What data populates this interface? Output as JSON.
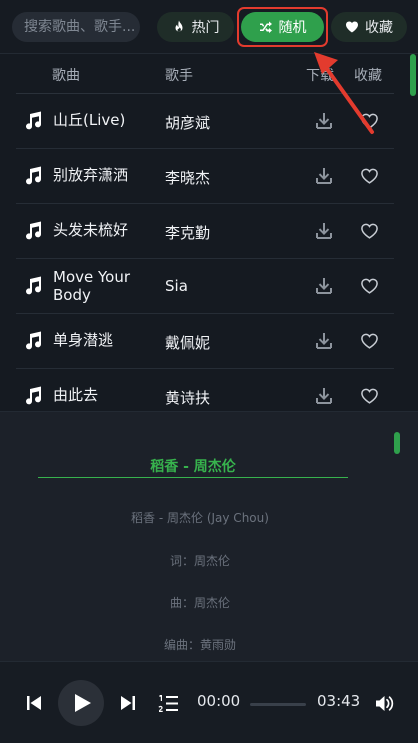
{
  "search": {
    "placeholder": "搜索歌曲、歌手..."
  },
  "tabs": [
    {
      "label": "热门",
      "icon": "flame-icon"
    },
    {
      "label": "随机",
      "icon": "shuffle-icon",
      "active": true
    },
    {
      "label": "收藏",
      "icon": "heart-icon"
    }
  ],
  "table": {
    "headers": {
      "song": "歌曲",
      "artist": "歌手",
      "download": "下载",
      "favorite": "收藏"
    },
    "rows": [
      {
        "title": "山丘(Live)",
        "artist": "胡彦斌"
      },
      {
        "title": "别放弃潇洒",
        "artist": "李晓杰"
      },
      {
        "title": "头发未梳好",
        "artist": "李克勤"
      },
      {
        "title": "Move Your Body",
        "artist": "Sia"
      },
      {
        "title": "单身潜逃",
        "artist": "戴佩妮"
      },
      {
        "title": "由此去",
        "artist": "黄诗扶"
      }
    ]
  },
  "lyrics": {
    "title": "稻香 - 周杰伦",
    "lines": [
      "稻香 - 周杰伦 (Jay Chou)",
      "词：周杰伦",
      "曲：周杰伦",
      "编曲：黄雨勋"
    ]
  },
  "player": {
    "current_time": "00:00",
    "total_time": "03:43",
    "progress": 0
  },
  "colors": {
    "accent": "#2fa04c",
    "annotation": "#e33b2e"
  }
}
